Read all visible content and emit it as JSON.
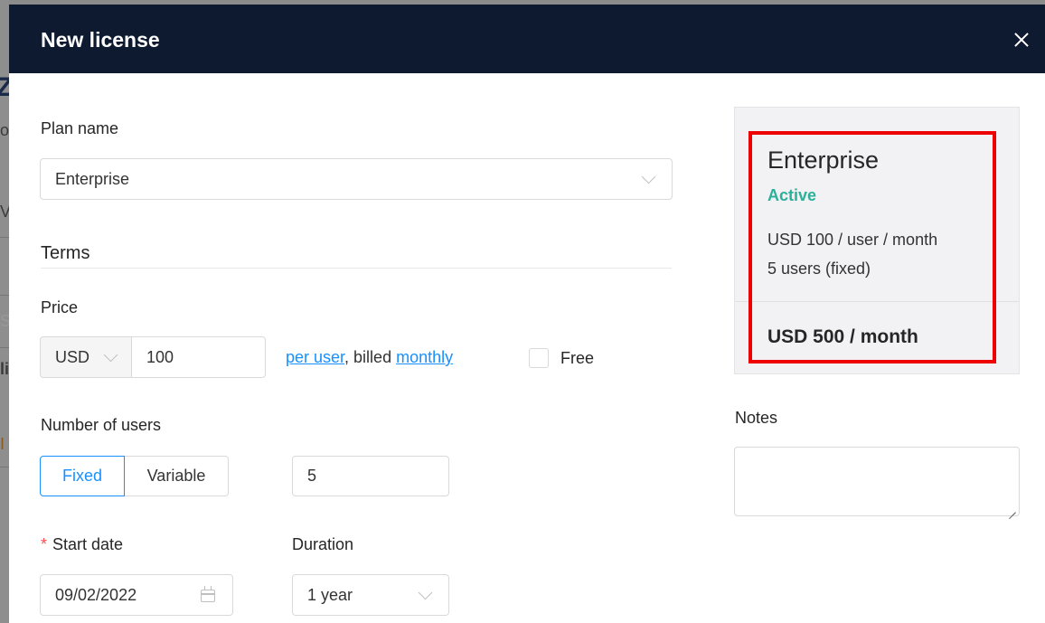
{
  "modal": {
    "title": "New license"
  },
  "plan": {
    "label": "Plan name",
    "value": "Enterprise"
  },
  "terms": {
    "title": "Terms"
  },
  "price": {
    "label": "Price",
    "currency": "USD",
    "amount": "100",
    "per_user_link": "per user",
    "billed_text": ", billed ",
    "billing_link": "monthly",
    "free_label": "Free",
    "free_checked": false
  },
  "users": {
    "label": "Number of users",
    "fixed_label": "Fixed",
    "variable_label": "Variable",
    "selected": "Fixed",
    "count": "5"
  },
  "start_date": {
    "required_mark": "*",
    "label": "Start date",
    "value": "09/02/2022"
  },
  "duration": {
    "label": "Duration",
    "value": "1 year"
  },
  "summary": {
    "plan_name": "Enterprise",
    "status": "Active",
    "price_line": "USD 100 / user / month",
    "users_line": "5 users (fixed)",
    "total": "USD 500 / month"
  },
  "notes": {
    "label": "Notes",
    "value": ""
  },
  "colors": {
    "header_bg": "#0e1a2f",
    "accent": "#1890ff",
    "status_active": "#2bb09a",
    "highlight": "#ee0000",
    "required": "#ff4d4f"
  },
  "background_fragments": [
    "Z",
    "o",
    "V",
    "S",
    "li",
    "I"
  ]
}
